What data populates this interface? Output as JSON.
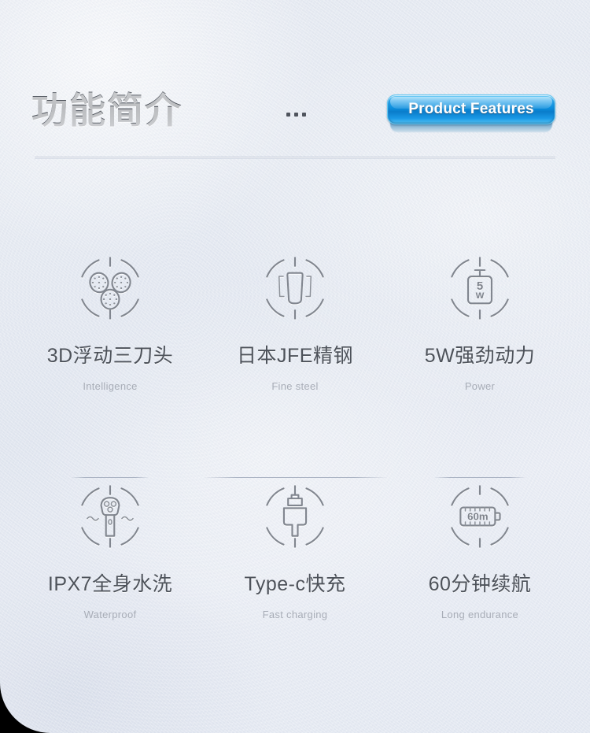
{
  "header": {
    "title": "功能简介",
    "dots": "...",
    "badge_label": "Product Features"
  },
  "features": [
    {
      "icon": "triple-shaver-head-icon",
      "label": "3D浮动三刀头",
      "sublabel": "Intelligence"
    },
    {
      "icon": "steel-blade-icon",
      "label": "日本JFE精钢",
      "sublabel": "Fine steel"
    },
    {
      "icon": "motor-power-icon",
      "label": "5W强劲动力",
      "sublabel": "Power",
      "icon_text_top": "5",
      "icon_text_bottom": "W"
    },
    {
      "icon": "waterproof-shaver-icon",
      "label": "IPX7全身水洗",
      "sublabel": "Waterproof"
    },
    {
      "icon": "usb-plug-icon",
      "label": "Type-c快充",
      "sublabel": "Fast charging"
    },
    {
      "icon": "battery-endurance-icon",
      "label": "60分钟续航",
      "sublabel": "Long endurance",
      "icon_text": "60m"
    }
  ],
  "colors": {
    "background": "#e7ebf3",
    "title_text": "#4a4f57",
    "label_text": "#4d525a",
    "sublabel_text": "#a8adb7",
    "icon_stroke": "#81868f",
    "badge_blue": "#0b8ddc",
    "badge_blue_light": "#5fc8f5",
    "divider": "#a4adbe"
  }
}
